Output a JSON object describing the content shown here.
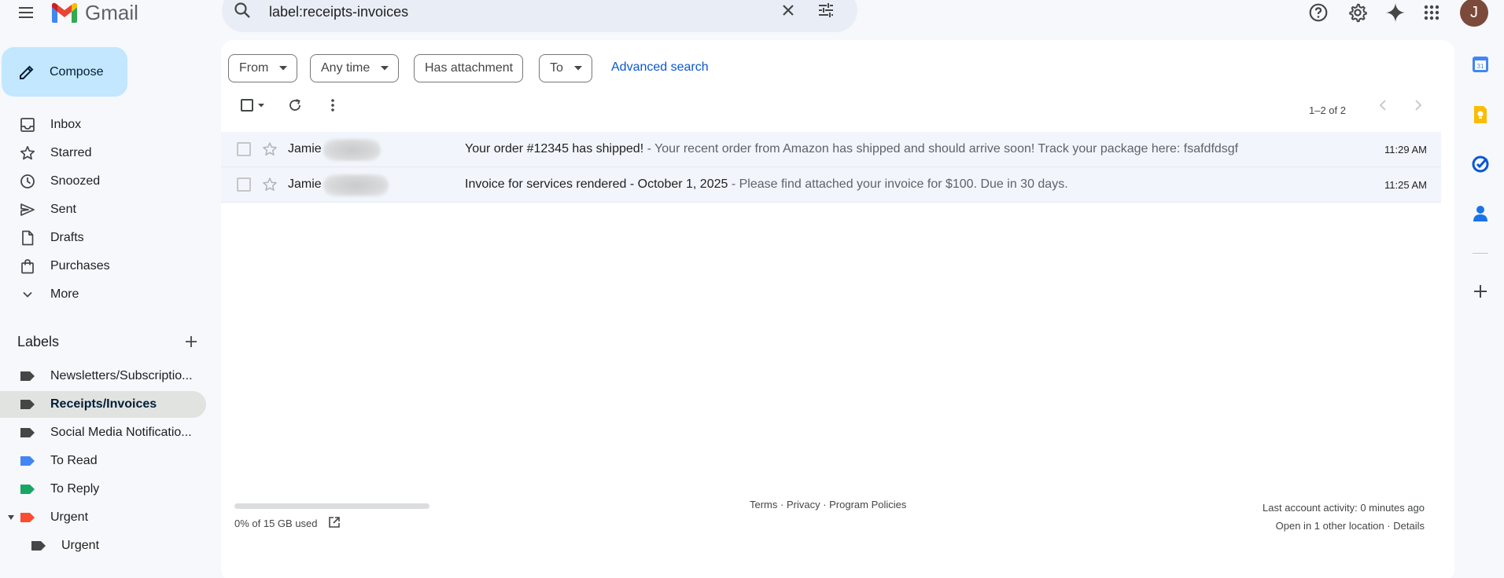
{
  "app": {
    "name": "Gmail"
  },
  "search": {
    "query": "label:receipts-invoices"
  },
  "header_icons": [
    "help-icon",
    "settings-icon",
    "gemini-sparkle-icon",
    "apps-grid-icon"
  ],
  "account": {
    "avatar_letter": "J",
    "avatar_color": "#7b4a3a"
  },
  "compose": {
    "label": "Compose"
  },
  "nav": [
    {
      "label": "Inbox",
      "icon": "inbox-icon"
    },
    {
      "label": "Starred",
      "icon": "star-icon"
    },
    {
      "label": "Snoozed",
      "icon": "clock-icon"
    },
    {
      "label": "Sent",
      "icon": "send-icon"
    },
    {
      "label": "Drafts",
      "icon": "draft-icon"
    },
    {
      "label": "Purchases",
      "icon": "shopping-bag-icon"
    },
    {
      "label": "More",
      "icon": "chevron-down-icon"
    }
  ],
  "labels": {
    "heading": "Labels",
    "items": [
      {
        "label": "Newsletters/Subscriptio...",
        "color": "#444746",
        "active": false
      },
      {
        "label": "Receipts/Invoices",
        "color": "#444746",
        "active": true
      },
      {
        "label": "Social Media Notificatio...",
        "color": "#444746",
        "active": false
      },
      {
        "label": "To Read",
        "color": "#4285f4",
        "active": false
      },
      {
        "label": "To Reply",
        "color": "#16a765",
        "active": false
      },
      {
        "label": "Urgent",
        "color": "#fb4c2f",
        "active": false,
        "expanded": true
      },
      {
        "label": "Urgent",
        "color": "#444746",
        "active": false,
        "nested": true
      }
    ]
  },
  "filters": {
    "chips": [
      "From",
      "Any time",
      "Has attachment",
      "To"
    ],
    "advanced": "Advanced search"
  },
  "toolbar": {
    "count": "1–2 of 2"
  },
  "emails": [
    {
      "sender": "Jamie",
      "subject": "Your order #12345 has shipped!",
      "snippet": " - Your recent order from Amazon has shipped and should arrive soon! Track your package here: fsafdfdsgf",
      "time": "11:29 AM"
    },
    {
      "sender": "Jamie",
      "subject": "Invoice for services rendered - October 1, 2025",
      "snippet": " - Please find attached your invoice for $100. Due in 30 days.",
      "time": "11:25 AM"
    }
  ],
  "footer": {
    "storage": "0% of 15 GB used",
    "storage_fraction": 0,
    "terms": "Terms",
    "privacy": "Privacy",
    "policies": "Program Policies",
    "activity": "Last account activity: 0 minutes ago",
    "location": "Open in 1 other location",
    "details": "Details"
  },
  "side_panel": [
    "calendar-icon",
    "keep-icon",
    "tasks-icon",
    "contacts-icon",
    "add-icon"
  ]
}
